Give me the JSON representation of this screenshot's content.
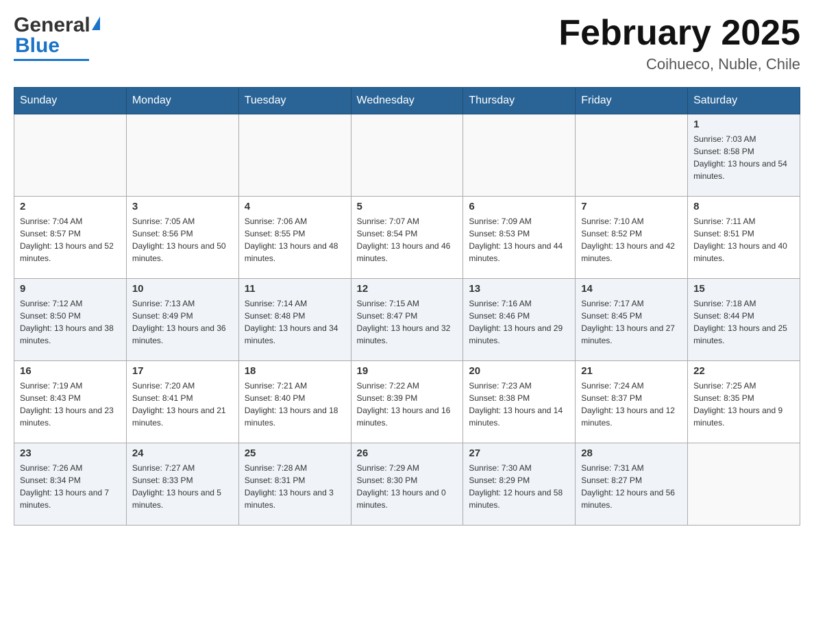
{
  "header": {
    "logo": {
      "part1": "General",
      "part2": "Blue"
    },
    "title": "February 2025",
    "location": "Coihueco, Nuble, Chile"
  },
  "days_of_week": [
    "Sunday",
    "Monday",
    "Tuesday",
    "Wednesday",
    "Thursday",
    "Friday",
    "Saturday"
  ],
  "weeks": [
    [
      {
        "day": "",
        "sunrise": "",
        "sunset": "",
        "daylight": ""
      },
      {
        "day": "",
        "sunrise": "",
        "sunset": "",
        "daylight": ""
      },
      {
        "day": "",
        "sunrise": "",
        "sunset": "",
        "daylight": ""
      },
      {
        "day": "",
        "sunrise": "",
        "sunset": "",
        "daylight": ""
      },
      {
        "day": "",
        "sunrise": "",
        "sunset": "",
        "daylight": ""
      },
      {
        "day": "",
        "sunrise": "",
        "sunset": "",
        "daylight": ""
      },
      {
        "day": "1",
        "sunrise": "Sunrise: 7:03 AM",
        "sunset": "Sunset: 8:58 PM",
        "daylight": "Daylight: 13 hours and 54 minutes."
      }
    ],
    [
      {
        "day": "2",
        "sunrise": "Sunrise: 7:04 AM",
        "sunset": "Sunset: 8:57 PM",
        "daylight": "Daylight: 13 hours and 52 minutes."
      },
      {
        "day": "3",
        "sunrise": "Sunrise: 7:05 AM",
        "sunset": "Sunset: 8:56 PM",
        "daylight": "Daylight: 13 hours and 50 minutes."
      },
      {
        "day": "4",
        "sunrise": "Sunrise: 7:06 AM",
        "sunset": "Sunset: 8:55 PM",
        "daylight": "Daylight: 13 hours and 48 minutes."
      },
      {
        "day": "5",
        "sunrise": "Sunrise: 7:07 AM",
        "sunset": "Sunset: 8:54 PM",
        "daylight": "Daylight: 13 hours and 46 minutes."
      },
      {
        "day": "6",
        "sunrise": "Sunrise: 7:09 AM",
        "sunset": "Sunset: 8:53 PM",
        "daylight": "Daylight: 13 hours and 44 minutes."
      },
      {
        "day": "7",
        "sunrise": "Sunrise: 7:10 AM",
        "sunset": "Sunset: 8:52 PM",
        "daylight": "Daylight: 13 hours and 42 minutes."
      },
      {
        "day": "8",
        "sunrise": "Sunrise: 7:11 AM",
        "sunset": "Sunset: 8:51 PM",
        "daylight": "Daylight: 13 hours and 40 minutes."
      }
    ],
    [
      {
        "day": "9",
        "sunrise": "Sunrise: 7:12 AM",
        "sunset": "Sunset: 8:50 PM",
        "daylight": "Daylight: 13 hours and 38 minutes."
      },
      {
        "day": "10",
        "sunrise": "Sunrise: 7:13 AM",
        "sunset": "Sunset: 8:49 PM",
        "daylight": "Daylight: 13 hours and 36 minutes."
      },
      {
        "day": "11",
        "sunrise": "Sunrise: 7:14 AM",
        "sunset": "Sunset: 8:48 PM",
        "daylight": "Daylight: 13 hours and 34 minutes."
      },
      {
        "day": "12",
        "sunrise": "Sunrise: 7:15 AM",
        "sunset": "Sunset: 8:47 PM",
        "daylight": "Daylight: 13 hours and 32 minutes."
      },
      {
        "day": "13",
        "sunrise": "Sunrise: 7:16 AM",
        "sunset": "Sunset: 8:46 PM",
        "daylight": "Daylight: 13 hours and 29 minutes."
      },
      {
        "day": "14",
        "sunrise": "Sunrise: 7:17 AM",
        "sunset": "Sunset: 8:45 PM",
        "daylight": "Daylight: 13 hours and 27 minutes."
      },
      {
        "day": "15",
        "sunrise": "Sunrise: 7:18 AM",
        "sunset": "Sunset: 8:44 PM",
        "daylight": "Daylight: 13 hours and 25 minutes."
      }
    ],
    [
      {
        "day": "16",
        "sunrise": "Sunrise: 7:19 AM",
        "sunset": "Sunset: 8:43 PM",
        "daylight": "Daylight: 13 hours and 23 minutes."
      },
      {
        "day": "17",
        "sunrise": "Sunrise: 7:20 AM",
        "sunset": "Sunset: 8:41 PM",
        "daylight": "Daylight: 13 hours and 21 minutes."
      },
      {
        "day": "18",
        "sunrise": "Sunrise: 7:21 AM",
        "sunset": "Sunset: 8:40 PM",
        "daylight": "Daylight: 13 hours and 18 minutes."
      },
      {
        "day": "19",
        "sunrise": "Sunrise: 7:22 AM",
        "sunset": "Sunset: 8:39 PM",
        "daylight": "Daylight: 13 hours and 16 minutes."
      },
      {
        "day": "20",
        "sunrise": "Sunrise: 7:23 AM",
        "sunset": "Sunset: 8:38 PM",
        "daylight": "Daylight: 13 hours and 14 minutes."
      },
      {
        "day": "21",
        "sunrise": "Sunrise: 7:24 AM",
        "sunset": "Sunset: 8:37 PM",
        "daylight": "Daylight: 13 hours and 12 minutes."
      },
      {
        "day": "22",
        "sunrise": "Sunrise: 7:25 AM",
        "sunset": "Sunset: 8:35 PM",
        "daylight": "Daylight: 13 hours and 9 minutes."
      }
    ],
    [
      {
        "day": "23",
        "sunrise": "Sunrise: 7:26 AM",
        "sunset": "Sunset: 8:34 PM",
        "daylight": "Daylight: 13 hours and 7 minutes."
      },
      {
        "day": "24",
        "sunrise": "Sunrise: 7:27 AM",
        "sunset": "Sunset: 8:33 PM",
        "daylight": "Daylight: 13 hours and 5 minutes."
      },
      {
        "day": "25",
        "sunrise": "Sunrise: 7:28 AM",
        "sunset": "Sunset: 8:31 PM",
        "daylight": "Daylight: 13 hours and 3 minutes."
      },
      {
        "day": "26",
        "sunrise": "Sunrise: 7:29 AM",
        "sunset": "Sunset: 8:30 PM",
        "daylight": "Daylight: 13 hours and 0 minutes."
      },
      {
        "day": "27",
        "sunrise": "Sunrise: 7:30 AM",
        "sunset": "Sunset: 8:29 PM",
        "daylight": "Daylight: 12 hours and 58 minutes."
      },
      {
        "day": "28",
        "sunrise": "Sunrise: 7:31 AM",
        "sunset": "Sunset: 8:27 PM",
        "daylight": "Daylight: 12 hours and 56 minutes."
      },
      {
        "day": "",
        "sunrise": "",
        "sunset": "",
        "daylight": ""
      }
    ]
  ]
}
